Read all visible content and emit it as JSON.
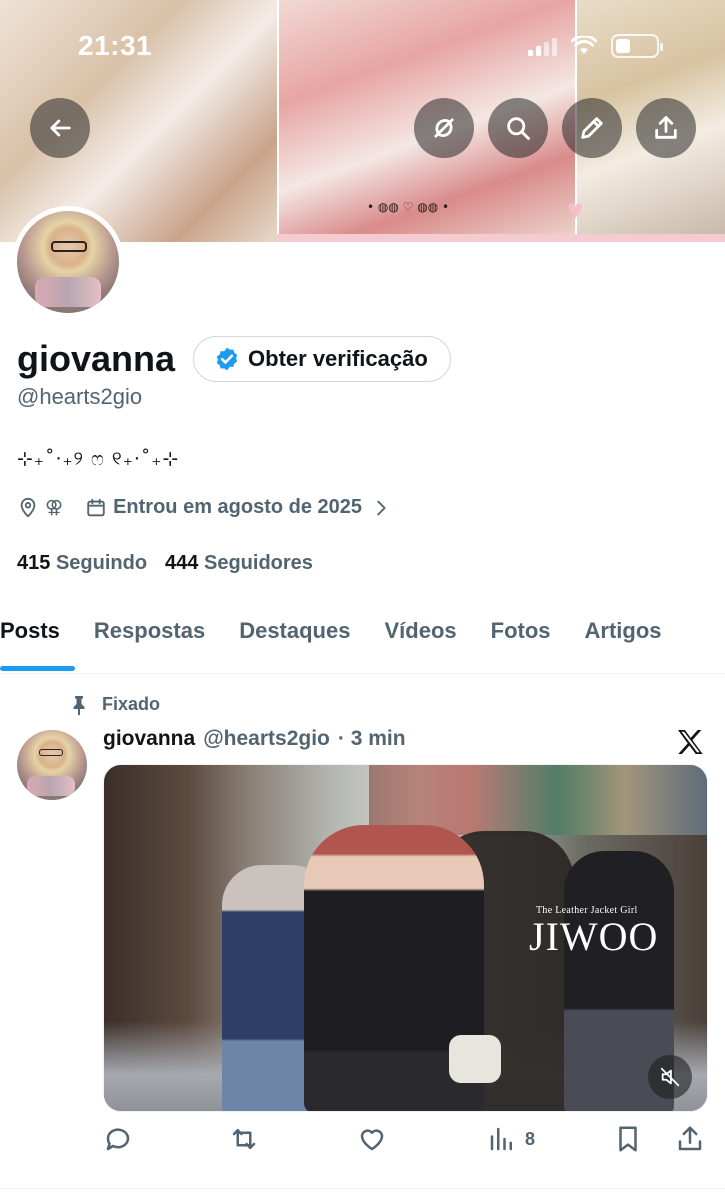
{
  "status_bar": {
    "time": "21:31",
    "battery_level": 0.35
  },
  "banner": {
    "tattoo_text": "• ◍◍ ♡ ◍◍ •"
  },
  "header_buttons": {
    "back": "back-arrow-icon",
    "grok": "grok-icon",
    "search": "search-icon",
    "edit": "pencil-icon",
    "share": "share-icon"
  },
  "profile": {
    "display_name": "giovanna",
    "verify_label": "Obter verificação",
    "handle": "@hearts2gio",
    "bio": "⊹₊˚‧₊୨ ෆ ୧₊‧˚₊⊹",
    "gender_glyph": "⚢",
    "joined": "Entrou em agosto de 2025",
    "following_count": "415",
    "following_label": "Seguindo",
    "followers_count": "444",
    "followers_label": "Seguidores"
  },
  "tabs": [
    {
      "label": "Posts",
      "active": true
    },
    {
      "label": "Respostas"
    },
    {
      "label": "Destaques"
    },
    {
      "label": "Vídeos"
    },
    {
      "label": "Fotos"
    },
    {
      "label": "Artigos"
    }
  ],
  "post": {
    "pinned_label": "Fixado",
    "author_name": "giovanna",
    "author_handle": "@hearts2gio",
    "time": "· 3 min",
    "media": {
      "watermark_small": "The Leather Jacket Girl",
      "watermark_big": "JIWOO"
    },
    "actions": {
      "views_count": "8"
    }
  },
  "colors": {
    "accent": "#1d9bf0",
    "text_primary": "#0f1419",
    "text_secondary": "#536471"
  }
}
